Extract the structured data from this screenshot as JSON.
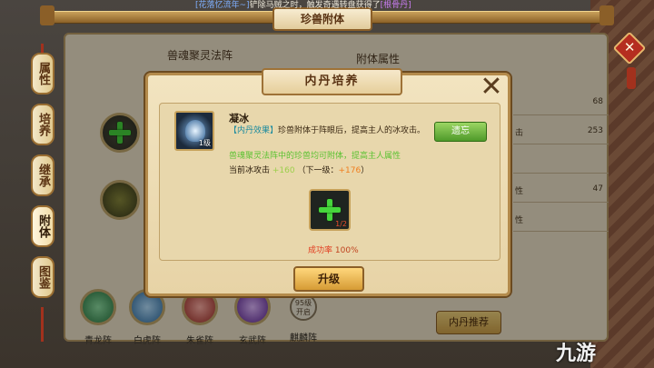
{
  "header": {
    "title": "珍兽附体",
    "ticker": {
      "tag": "[花落忆流年~]",
      "text": "铲除马贼之时，触发奇遇转盘获得了",
      "item": "[根骨丹]"
    }
  },
  "side_tabs": [
    "属性",
    "培养",
    "继承",
    "附体",
    "图鉴"
  ],
  "active_tab": "附体",
  "left_section_title": "兽魂聚灵法阵",
  "right_section_title": "附体属性",
  "attributes": [
    {
      "k": "",
      "v": "68"
    },
    {
      "k": "击",
      "v": "253"
    },
    {
      "k": "",
      "v": ""
    },
    {
      "k": "性",
      "v": "47"
    },
    {
      "k": "性",
      "v": ""
    }
  ],
  "formations": [
    {
      "label": "青龙阵",
      "color": "#3a9d59"
    },
    {
      "label": "白虎阵",
      "color": "#4f9fd2"
    },
    {
      "label": "朱雀阵",
      "color": "#d24a45"
    },
    {
      "label": "玄武阵",
      "color": "#8a42c5"
    },
    {
      "label": "麒麟阵",
      "locked": "95级开启"
    }
  ],
  "right_button": "内丹推荐",
  "watermark": "九游",
  "modal": {
    "title": "内丹培养",
    "close": "✕",
    "item": {
      "name": "凝冰",
      "level": "1级",
      "desc_prefix": "【内丹效果】",
      "desc_body": "珍兽附体于阵眼后，提高主人的冰攻击。",
      "green_hint": "兽魂聚灵法阵中的珍兽均可附体，提高主人属性",
      "current_label": "当前冰攻击",
      "current_value": "+160",
      "next_label": "（下一级：",
      "next_value": "+176",
      "next_suffix": "）"
    },
    "forget_button": "遗忘",
    "material_count": "1/2",
    "success_rate_label": "成功率",
    "success_rate_value": "100%",
    "upgrade_button": "升级"
  }
}
